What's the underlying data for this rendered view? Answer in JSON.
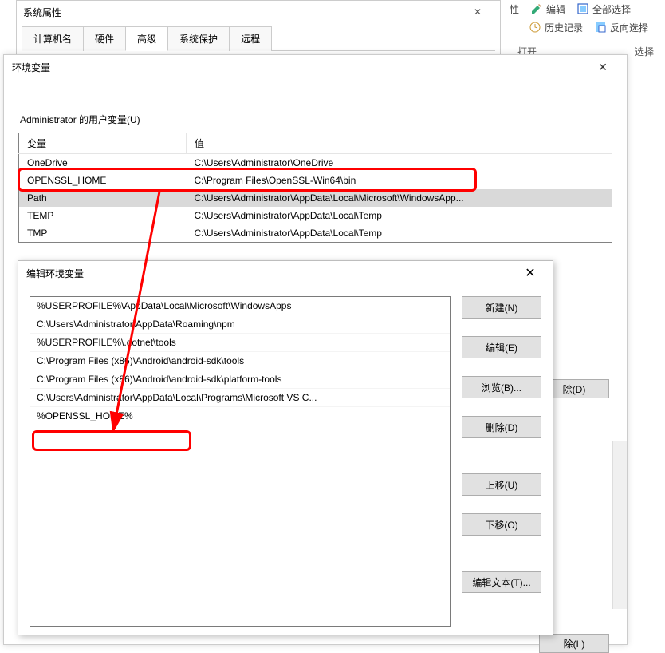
{
  "sysprop": {
    "title": "系统属性",
    "tabs": [
      "计算机名",
      "硬件",
      "高级",
      "系统保护",
      "远程"
    ],
    "active_tab": 2
  },
  "ribbon": {
    "row1": [
      {
        "name": "properties",
        "label": "性",
        "icon": ""
      },
      {
        "name": "edit-right",
        "label": "编辑",
        "icon": "pencil"
      },
      {
        "name": "select-all",
        "label": "全部选择",
        "icon": ""
      }
    ],
    "history": "历史记录",
    "invert": "反向选择",
    "sec_open": "打开",
    "sec_select": "选择"
  },
  "env": {
    "title": "环境变量",
    "user_section": "Administrator 的用户变量(U)",
    "col_var": "变量",
    "col_val": "值",
    "rows": [
      {
        "name": "OneDrive",
        "value": "C:\\Users\\Administrator\\OneDrive",
        "sel": false
      },
      {
        "name": "OPENSSL_HOME",
        "value": "C:\\Program Files\\OpenSSL-Win64\\bin",
        "sel": false
      },
      {
        "name": "Path",
        "value": "C:\\Users\\Administrator\\AppData\\Local\\Microsoft\\WindowsApp...",
        "sel": true
      },
      {
        "name": "TEMP",
        "value": "C:\\Users\\Administrator\\AppData\\Local\\Temp",
        "sel": false
      },
      {
        "name": "TMP",
        "value": "C:\\Users\\Administrator\\AppData\\Local\\Temp",
        "sel": false
      }
    ],
    "partial_btn_d": "除(D)",
    "partial_btn_l": "除(L)"
  },
  "edit": {
    "title": "编辑环境变量",
    "paths": [
      "%USERPROFILE%\\AppData\\Local\\Microsoft\\WindowsApps",
      "C:\\Users\\Administrator\\AppData\\Roaming\\npm",
      "%USERPROFILE%\\.dotnet\\tools",
      "C:\\Program Files (x86)\\Android\\android-sdk\\tools",
      "C:\\Program Files (x86)\\Android\\android-sdk\\platform-tools",
      "C:\\Users\\Administrator\\AppData\\Local\\Programs\\Microsoft VS C...",
      "%OPENSSL_HOME%"
    ],
    "buttons": {
      "new": "新建(N)",
      "edit": "编辑(E)",
      "browse": "浏览(B)...",
      "delete": "删除(D)",
      "up": "上移(U)",
      "down": "下移(O)",
      "edit_text": "编辑文本(T)..."
    }
  }
}
